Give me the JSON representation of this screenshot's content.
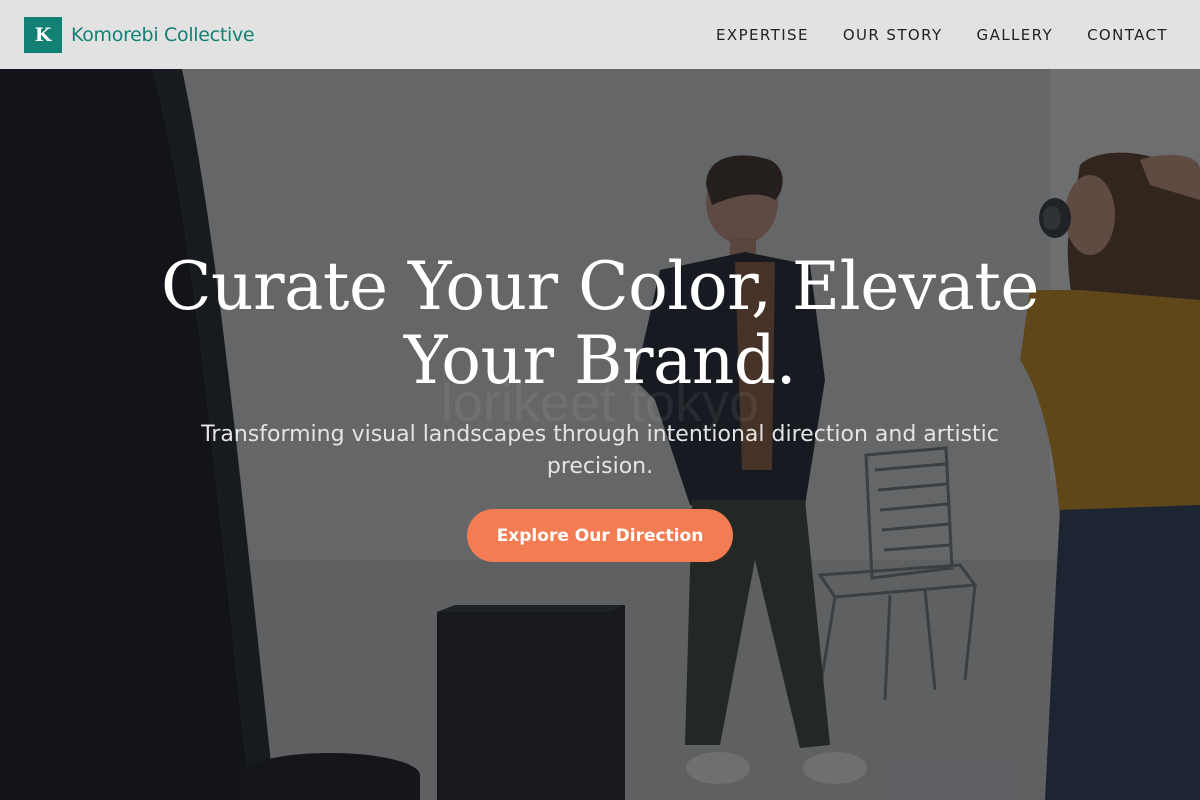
{
  "brand": {
    "mark": "K",
    "name": "Komorebi Collective",
    "color": "#128075"
  },
  "nav": {
    "items": [
      {
        "label": "EXPERTISE"
      },
      {
        "label": "OUR STORY"
      },
      {
        "label": "GALLERY"
      },
      {
        "label": "CONTACT"
      }
    ]
  },
  "hero": {
    "headline_line1": "Curate Your Color, Elevate",
    "headline_line2": "Your Brand.",
    "watermark": "lorikeet tokyo",
    "subtitle_line1": "Transforming visual landscapes through intentional direction and artistic",
    "subtitle_line2": "precision.",
    "cta_label": "Explore Our Direction",
    "cta_color": "#f47c52"
  }
}
